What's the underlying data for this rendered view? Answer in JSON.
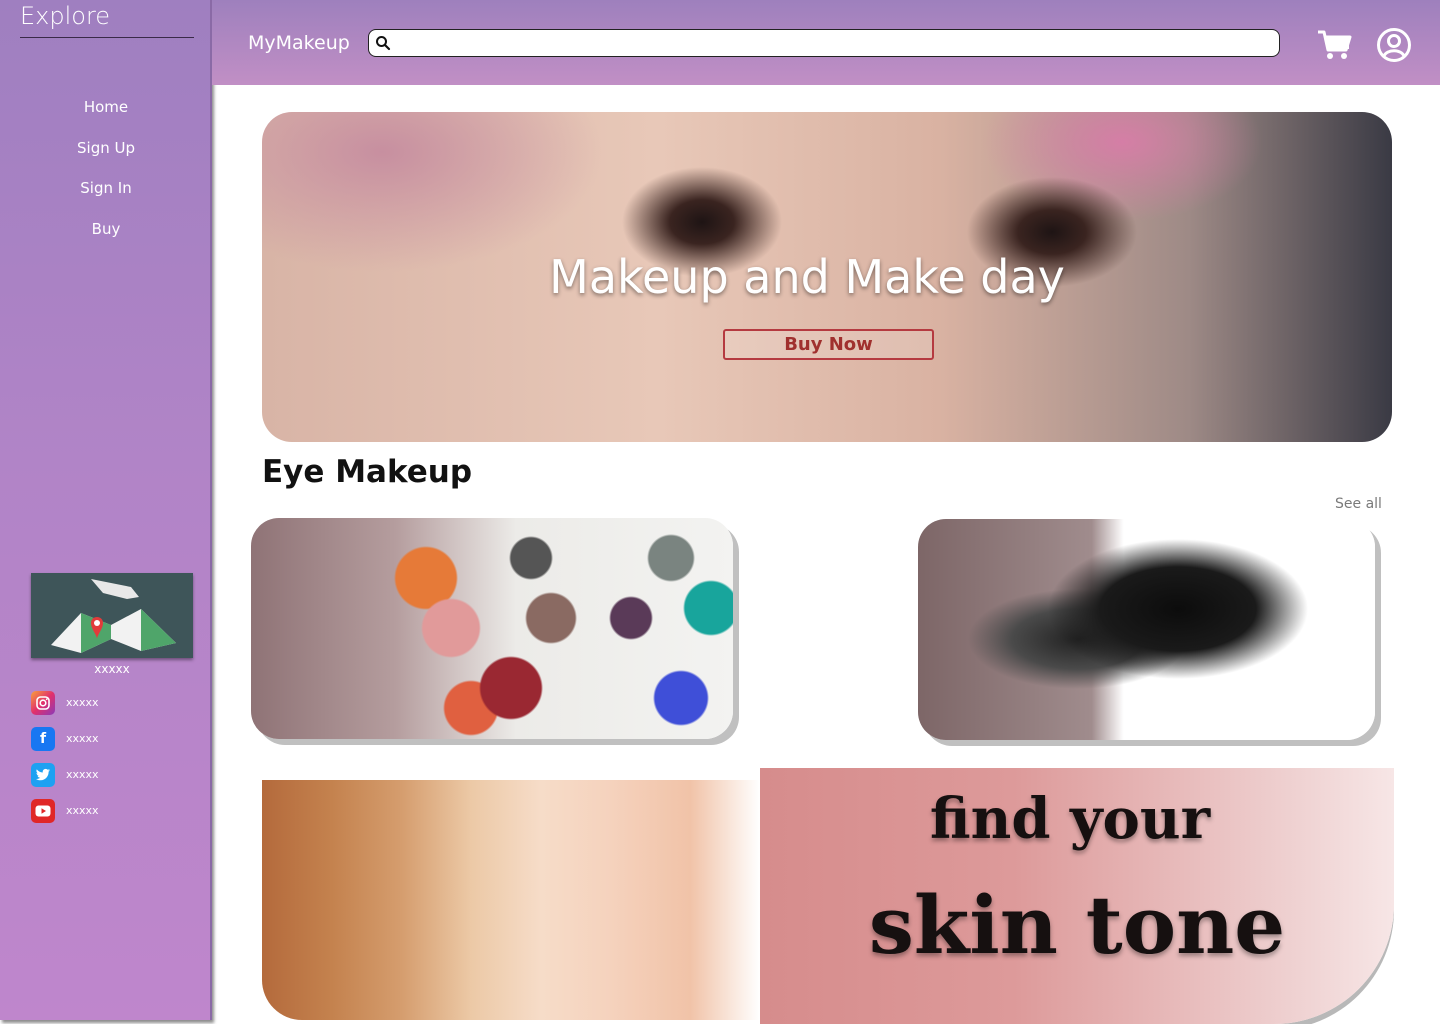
{
  "sidebar": {
    "title": "Explore",
    "nav": [
      {
        "label": "Home"
      },
      {
        "label": "Sign Up"
      },
      {
        "label": "Sign In"
      },
      {
        "label": "Buy"
      }
    ],
    "map_caption": "xxxxx",
    "socials": [
      {
        "icon": "instagram-icon",
        "label": "xxxxx",
        "color": "#e1306c"
      },
      {
        "icon": "facebook-icon",
        "label": "xxxxx",
        "color": "#1877f2"
      },
      {
        "icon": "twitter-icon",
        "label": "xxxxx",
        "color": "#1da1f2"
      },
      {
        "icon": "youtube-icon",
        "label": "xxxxx",
        "color": "#e02727"
      }
    ]
  },
  "header": {
    "brand": "MyMakeup",
    "search": {
      "value": "",
      "placeholder": ""
    }
  },
  "hero": {
    "title": "Makeup and Make day",
    "button_label": "Buy Now"
  },
  "eye_section": {
    "title": "Eye Makeup",
    "see_all": "See all"
  },
  "skin_banner": {
    "line1": "find your",
    "line2": "skin tone"
  },
  "colors": {
    "sidebar_top": "#9f7fc0",
    "sidebar_bottom": "#bf86cc",
    "accent_red": "#b53a40",
    "banner_pink": "#d68c8c"
  }
}
